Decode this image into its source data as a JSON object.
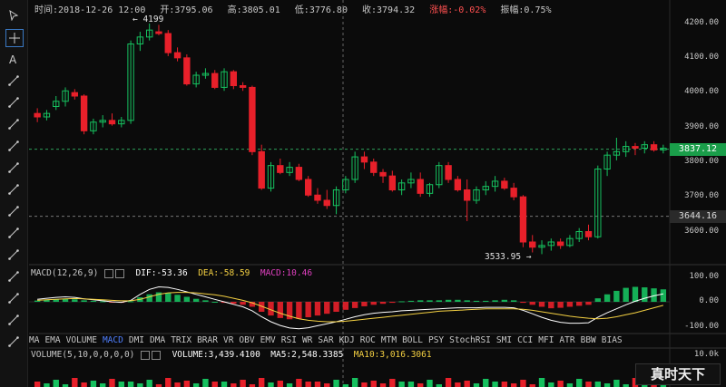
{
  "info": {
    "time": "时间:2018-12-26 12:00",
    "open": "开:3795.06",
    "high": "高:3805.01",
    "low": "低:3776.80",
    "close": "收:3794.32",
    "change": "涨幅:-0.02%",
    "amplitude": "振幅:0.75%"
  },
  "toolbar": {
    "icons": [
      "cursor-arrow-icon",
      "crosshair-icon",
      "text-icon",
      "horizontal-line-icon",
      "horizontal-ray-icon",
      "vertical-line-icon",
      "parallel-lines-icon",
      "price-channel-icon",
      "trend-line-icon",
      "ray-line-icon",
      "fib-icon",
      "fork-icon",
      "pitchfork-icon",
      "gann-icon",
      "wave-icon",
      "trash-icon"
    ]
  },
  "chart_data": {
    "type": "candlestick",
    "price_axis": {
      "ticks": [
        "4200.00",
        "4100.00",
        "4000.00",
        "3900.00",
        "3800.00",
        "3700.00",
        "3600.00"
      ],
      "ylim": [
        3510,
        4230
      ]
    },
    "current_price": "3837.12",
    "crosshair_price": "3644.16",
    "high_label": "4199",
    "low_label": "3533.95",
    "colors": {
      "up": "#16c15f",
      "down": "#e8202a",
      "current_tag": "#1a9e4a"
    },
    "candles": [
      [
        3940,
        3955,
        3915,
        3930
      ],
      [
        3930,
        3950,
        3920,
        3940
      ],
      [
        3960,
        3990,
        3950,
        3975
      ],
      [
        3975,
        4015,
        3960,
        4005
      ],
      [
        4000,
        4010,
        3980,
        3990
      ],
      [
        3990,
        3995,
        3880,
        3890
      ],
      [
        3890,
        3925,
        3880,
        3915
      ],
      [
        3915,
        3935,
        3900,
        3920
      ],
      [
        3920,
        3940,
        3905,
        3910
      ],
      [
        3910,
        3930,
        3900,
        3920
      ],
      [
        3920,
        4150,
        3910,
        4140
      ],
      [
        4140,
        4175,
        4120,
        4160
      ],
      [
        4160,
        4199,
        4150,
        4180
      ],
      [
        4175,
        4195,
        4165,
        4170
      ],
      [
        4170,
        4180,
        4105,
        4115
      ],
      [
        4115,
        4130,
        4090,
        4100
      ],
      [
        4100,
        4110,
        4020,
        4025
      ],
      [
        4025,
        4060,
        4015,
        4050
      ],
      [
        4050,
        4070,
        4040,
        4055
      ],
      [
        4055,
        4065,
        4010,
        4015
      ],
      [
        4015,
        4070,
        4005,
        4060
      ],
      [
        4060,
        4065,
        4010,
        4020
      ],
      [
        4020,
        4030,
        4005,
        4015
      ],
      [
        4015,
        4020,
        3820,
        3830
      ],
      [
        3830,
        3850,
        3720,
        3725
      ],
      [
        3725,
        3800,
        3715,
        3790
      ],
      [
        3790,
        3810,
        3765,
        3770
      ],
      [
        3770,
        3800,
        3760,
        3785
      ],
      [
        3785,
        3795,
        3745,
        3750
      ],
      [
        3750,
        3760,
        3700,
        3705
      ],
      [
        3705,
        3725,
        3680,
        3690
      ],
      [
        3690,
        3720,
        3665,
        3675
      ],
      [
        3675,
        3730,
        3650,
        3720
      ],
      [
        3720,
        3760,
        3710,
        3750
      ],
      [
        3750,
        3830,
        3740,
        3815
      ],
      [
        3815,
        3830,
        3780,
        3800
      ],
      [
        3800,
        3810,
        3760,
        3770
      ],
      [
        3770,
        3780,
        3740,
        3760
      ],
      [
        3760,
        3775,
        3715,
        3720
      ],
      [
        3720,
        3750,
        3705,
        3740
      ],
      [
        3740,
        3770,
        3725,
        3750
      ],
      [
        3750,
        3770,
        3700,
        3710
      ],
      [
        3710,
        3740,
        3700,
        3735
      ],
      [
        3735,
        3800,
        3725,
        3790
      ],
      [
        3790,
        3800,
        3740,
        3750
      ],
      [
        3750,
        3760,
        3715,
        3720
      ],
      [
        3720,
        3750,
        3630,
        3690
      ],
      [
        3690,
        3730,
        3680,
        3720
      ],
      [
        3720,
        3745,
        3705,
        3730
      ],
      [
        3730,
        3760,
        3715,
        3745
      ],
      [
        3745,
        3755,
        3720,
        3725
      ],
      [
        3725,
        3740,
        3690,
        3700
      ],
      [
        3700,
        3705,
        3555,
        3570
      ],
      [
        3570,
        3590,
        3540,
        3555
      ],
      [
        3555,
        3575,
        3535,
        3560
      ],
      [
        3560,
        3580,
        3545,
        3570
      ],
      [
        3570,
        3580,
        3550,
        3560
      ],
      [
        3560,
        3590,
        3555,
        3580
      ],
      [
        3580,
        3610,
        3570,
        3600
      ],
      [
        3600,
        3620,
        3575,
        3585
      ],
      [
        3585,
        3790,
        3580,
        3780
      ],
      [
        3780,
        3830,
        3760,
        3820
      ],
      [
        3820,
        3870,
        3805,
        3830
      ],
      [
        3830,
        3860,
        3815,
        3845
      ],
      [
        3845,
        3855,
        3820,
        3840
      ],
      [
        3840,
        3860,
        3825,
        3850
      ],
      [
        3850,
        3860,
        3830,
        3835
      ],
      [
        3835,
        3850,
        3825,
        3840
      ]
    ]
  },
  "macd": {
    "title": "MACD(12,26,9)",
    "dif": "DIF:-53.36",
    "dea": "DEA:-58.59",
    "macd": "MACD:10.46",
    "ticks": [
      "100.00",
      "0.00",
      "-100.00"
    ],
    "ylim": [
      -120,
      120
    ],
    "hist": [
      5,
      8,
      10,
      12,
      10,
      6,
      4,
      2,
      -2,
      -4,
      2,
      18,
      30,
      38,
      35,
      28,
      20,
      12,
      6,
      0,
      -4,
      -8,
      -12,
      -20,
      -40,
      -55,
      -65,
      -70,
      -68,
      -62,
      -55,
      -48,
      -40,
      -32,
      -25,
      -18,
      -12,
      -8,
      -4,
      2,
      4,
      6,
      6,
      6,
      8,
      8,
      6,
      4,
      4,
      6,
      8,
      6,
      -4,
      -12,
      -20,
      -26,
      -24,
      -20,
      -16,
      -12,
      14,
      30,
      44,
      56,
      60,
      58,
      54,
      50
    ],
    "dif_line": [
      10,
      14,
      18,
      20,
      18,
      12,
      8,
      4,
      0,
      -2,
      6,
      30,
      50,
      60,
      58,
      50,
      40,
      30,
      20,
      10,
      0,
      -10,
      -20,
      -36,
      -60,
      -80,
      -95,
      -105,
      -108,
      -104,
      -96,
      -88,
      -80,
      -70,
      -60,
      -52,
      -46,
      -42,
      -40,
      -36,
      -34,
      -32,
      -30,
      -28,
      -26,
      -24,
      -24,
      -24,
      -22,
      -22,
      -22,
      -24,
      -34,
      -48,
      -62,
      -74,
      -82,
      -86,
      -86,
      -84,
      -62,
      -44,
      -28,
      -12,
      2,
      14,
      24,
      32
    ],
    "dea_line": [
      6,
      8,
      10,
      12,
      13,
      12,
      10,
      8,
      6,
      4,
      4,
      10,
      20,
      30,
      36,
      38,
      38,
      36,
      32,
      28,
      22,
      14,
      6,
      -4,
      -18,
      -32,
      -46,
      -58,
      -68,
      -74,
      -78,
      -80,
      -80,
      -78,
      -74,
      -70,
      -66,
      -62,
      -58,
      -54,
      -50,
      -46,
      -42,
      -38,
      -36,
      -34,
      -32,
      -30,
      -28,
      -28,
      -28,
      -28,
      -30,
      -34,
      -40,
      -46,
      -52,
      -58,
      -62,
      -66,
      -68,
      -66,
      -60,
      -52,
      -44,
      -34,
      -24,
      -14
    ]
  },
  "indicator_tabs": [
    "MA",
    "EMA",
    "VOLUME",
    "MACD",
    "DMI",
    "DMA",
    "TRIX",
    "BRAR",
    "VR",
    "OBV",
    "EMV",
    "RSI",
    "WR",
    "SAR",
    "KDJ",
    "ROC",
    "MTM",
    "BOLL",
    "PSY",
    "StochRSI",
    "SMI",
    "CCI",
    "MFI",
    "ATR",
    "BBW",
    "BIAS"
  ],
  "active_tab": "MACD",
  "volume": {
    "title": "VOLUME(5,10,0,0,0,0)",
    "vol": "VOLUME:3,439.4100",
    "ma5": "MA5:2,548.3385",
    "ma10": "MA10:3,016.3061",
    "top_tick": "10.0k"
  },
  "watermark": "真时天下"
}
